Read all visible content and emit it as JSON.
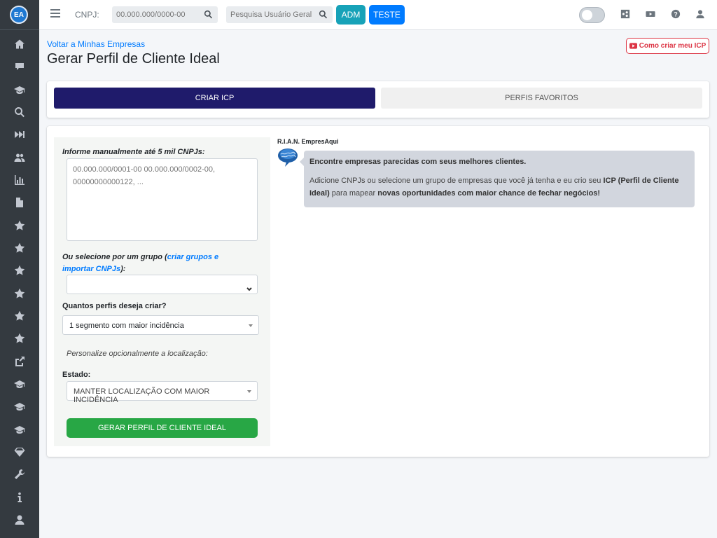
{
  "topbar": {
    "cnpj_label": "CNPJ:",
    "cnpj_placeholder": "00.000.000/0000-00",
    "user_search_placeholder": "Pesquisa Usuário Geral",
    "adm_label": "ADM",
    "teste_label": "TESTE"
  },
  "sidebar": {
    "logo_text": "EA",
    "icons": [
      "home-icon",
      "comment-icon",
      "graduation-cap-icon",
      "search-icon",
      "fast-forward-icon",
      "users-icon",
      "chart-bar-icon",
      "file-icon",
      "star-icon",
      "star-icon",
      "star-icon",
      "star-icon",
      "star-icon",
      "star-icon",
      "share-square-icon",
      "graduation-cap-icon",
      "graduation-cap-icon",
      "graduation-cap-icon",
      "gem-icon",
      "wrench-icon",
      "info-icon",
      "user-icon"
    ]
  },
  "header": {
    "back_link": "Voltar a Minhas Empresas",
    "title": "Gerar Perfil de Cliente Ideal",
    "video_button": "Como criar meu ICP"
  },
  "tabs": [
    {
      "label": "CRIAR ICP",
      "active": true
    },
    {
      "label": "PERFIS FAVORITOS",
      "active": false
    }
  ],
  "form": {
    "cnpj_list_label": "Informe manualmente até 5 mil CNPJs:",
    "cnpj_list_placeholder": "00.000.000/0001-00 00.000.000/0002-00, 00000000000122, ...",
    "group_label_prefix": "Ou selecione por um grupo (",
    "group_link": "criar grupos e importar CNPJs",
    "group_label_suffix": "):",
    "group_selected": "",
    "profiles_label": "Quantos perfis deseja criar?",
    "profiles_selected": "1 segmento com maior incidência",
    "personalize_text": "Personalize opcionalmente a localização:",
    "state_label": "Estado:",
    "state_selected": "MANTER LOCALIZAÇÃO COM MAIOR INCIDÊNCIA",
    "submit_label": "GERAR PERFIL DE CLIENTE IDEAL"
  },
  "assistant": {
    "name": "R.I.A.N. EmpresAqui",
    "line1": "Encontre empresas parecidas com seus melhores clientes.",
    "line2_a": "Adicione CNPJs ou selecione um grupo de empresas que você já tenha e eu crio seu ",
    "line2_b": "ICP (Perfil de Cliente Ideal)",
    "line2_c": " para mapear ",
    "line2_d": "novas oportunidades com maior chance de fechar negócios!"
  },
  "colors": {
    "sidebar_bg": "#343a40",
    "active_tab": "#1f1b6b",
    "adm_button": "#17a2b8",
    "teste_button": "#007bff",
    "submit_button": "#28a745",
    "video_button": "#dc3545"
  }
}
